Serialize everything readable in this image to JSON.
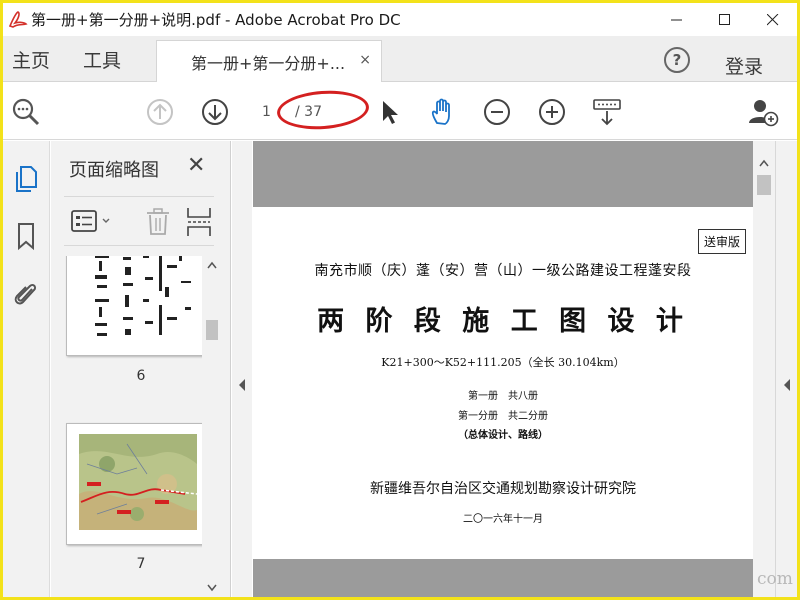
{
  "window": {
    "title": "第一册+第一分册+说明.pdf - Adobe Acrobat Pro DC",
    "controls": {
      "minimize": "—",
      "maximize": "☐",
      "close": "✕"
    }
  },
  "menu": {
    "home": "主页",
    "tools": "工具",
    "tab_label": "第一册+第一分册+...",
    "tab_close": "×",
    "help": "?",
    "login": "登录"
  },
  "toolbar": {
    "current_page": "1",
    "total_pages": "/ 37",
    "icons": [
      "zoom-search-icon",
      "page-up-icon",
      "page-down-icon",
      "select-cursor-icon",
      "hand-tool-icon",
      "zoom-out-icon",
      "zoom-in-icon",
      "keyboard-scroll-icon",
      "add-user-icon"
    ],
    "accent_color": "#1a73c8",
    "annotation_color": "#d42020"
  },
  "left_rail": {
    "icons": [
      "pages-icon",
      "bookmark-icon",
      "attachment-icon"
    ]
  },
  "thumbnail_panel": {
    "title": "页面缩略图",
    "close": "✕",
    "thumbnails": [
      {
        "label": "6"
      },
      {
        "label": "7"
      }
    ]
  },
  "document": {
    "stamp": "送审版",
    "subtitle": "南充市顺（庆）蓬（安）营（山）一级公路建设工程蓬安段",
    "title": "两 阶 段 施 工 图 设 计",
    "range": "K21+300～K52+111.205（全长 30.104km）",
    "volume": "第一册　共八册",
    "subvolume": "第一分册　共二分册",
    "content": "（总体设计、路线）",
    "org": "新疆维吾尔自治区交通规划勘察设计研究院",
    "date": "二〇一六年十一月"
  },
  "watermark": "com"
}
